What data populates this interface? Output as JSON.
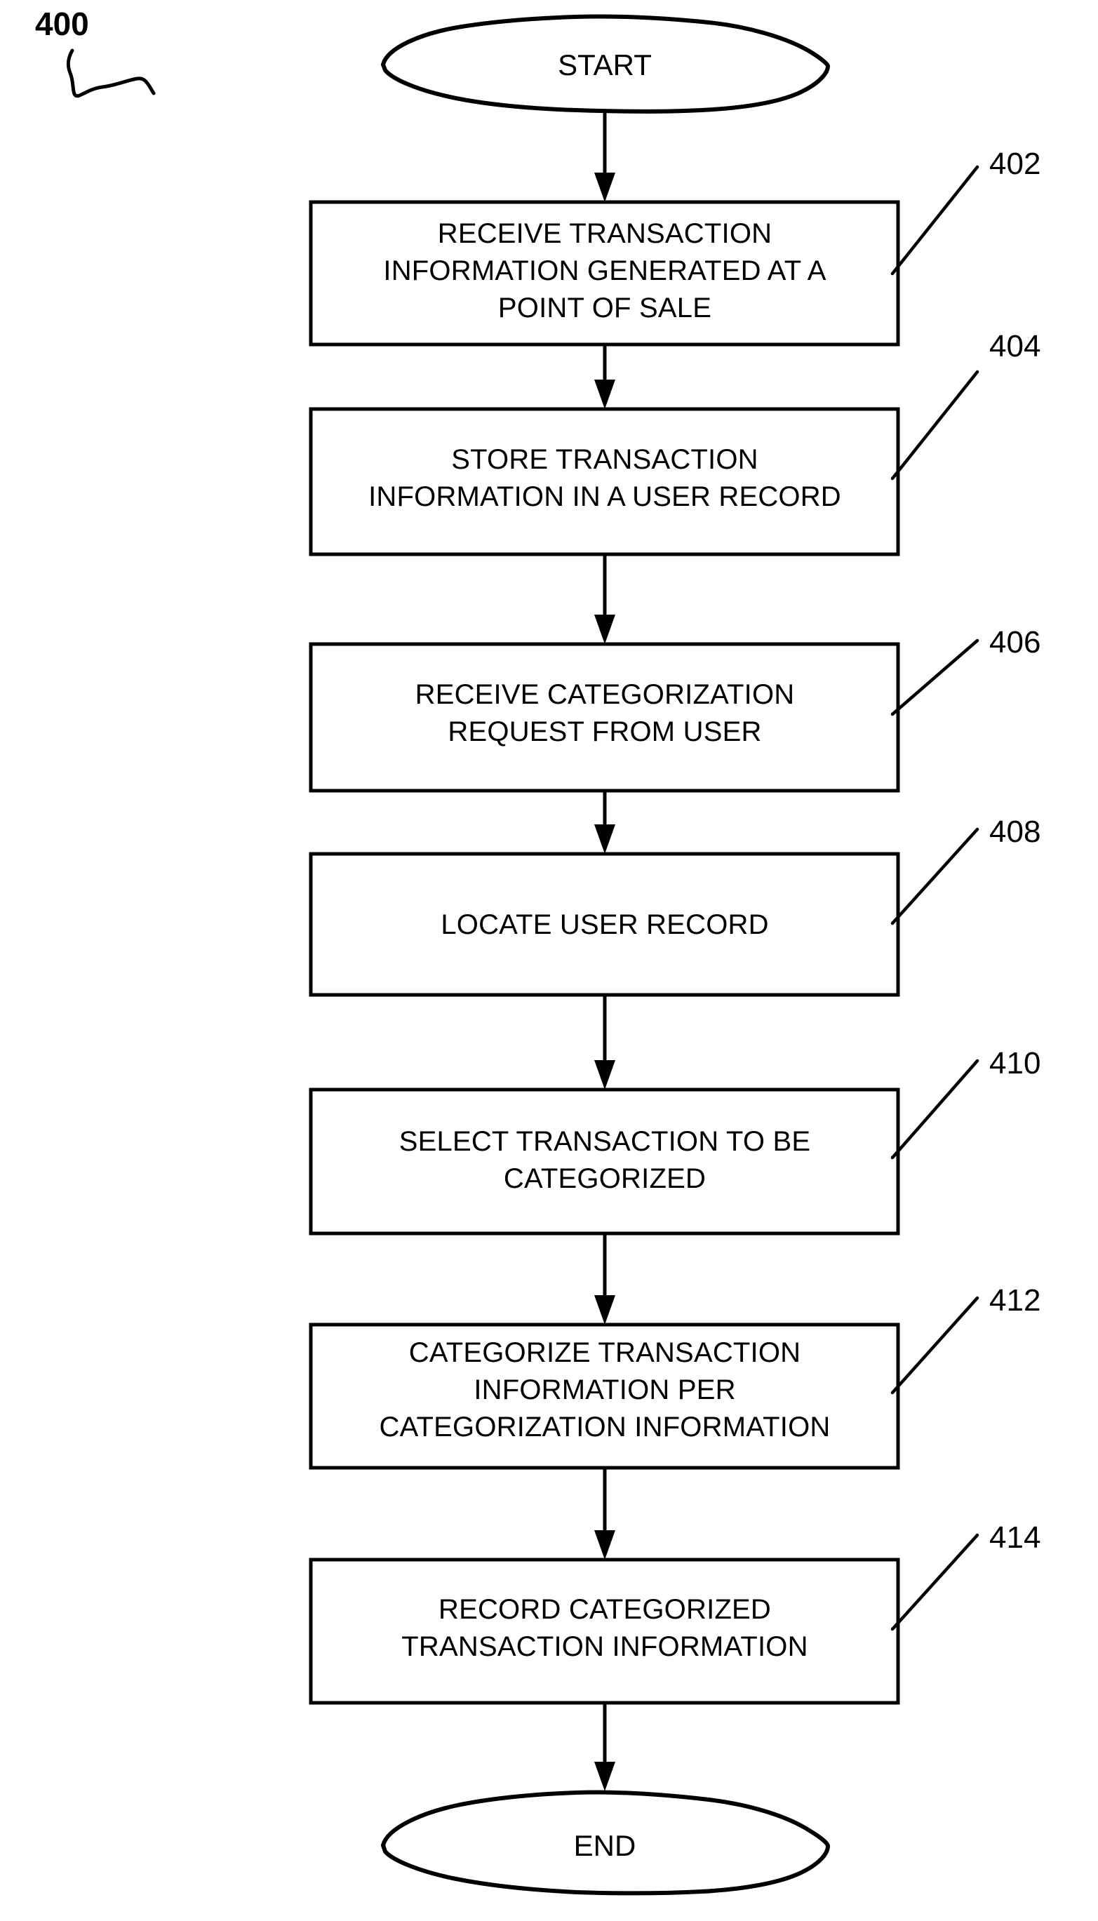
{
  "figure": {
    "number": "400",
    "type": "patent-flowchart"
  },
  "terminals": {
    "start": {
      "label": "START"
    },
    "end": {
      "label": "END"
    }
  },
  "steps": [
    {
      "ref": "402",
      "lines": [
        "RECEIVE TRANSACTION",
        "INFORMATION GENERATED AT A",
        "POINT OF SALE"
      ]
    },
    {
      "ref": "404",
      "lines": [
        "STORE TRANSACTION",
        "INFORMATION IN A USER RECORD"
      ]
    },
    {
      "ref": "406",
      "lines": [
        "RECEIVE CATEGORIZATION",
        "REQUEST FROM USER"
      ]
    },
    {
      "ref": "408",
      "lines": [
        "LOCATE USER RECORD"
      ]
    },
    {
      "ref": "410",
      "lines": [
        "SELECT TRANSACTION TO BE",
        "CATEGORIZED"
      ]
    },
    {
      "ref": "412",
      "lines": [
        "CATEGORIZE TRANSACTION",
        "INFORMATION PER",
        "CATEGORIZATION INFORMATION"
      ]
    },
    {
      "ref": "414",
      "lines": [
        "RECORD CATEGORIZED",
        "TRANSACTION INFORMATION"
      ]
    }
  ],
  "colors": {
    "ink": "#000000",
    "paper": "#ffffff"
  }
}
